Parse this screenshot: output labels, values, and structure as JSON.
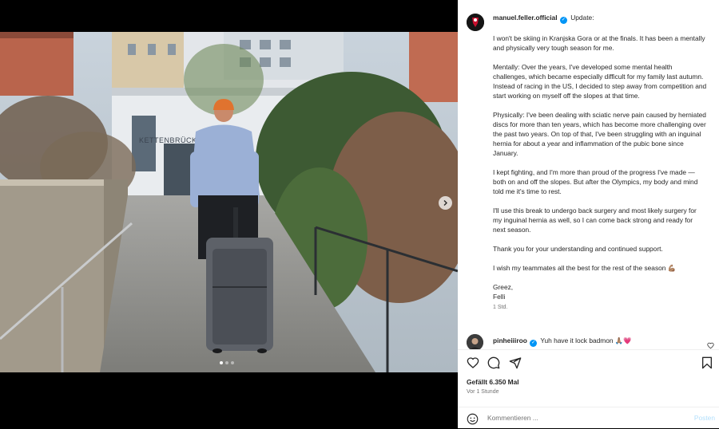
{
  "post": {
    "username": "manuel.feller.official",
    "verified": true,
    "caption_first": "Update:",
    "paragraphs": [
      "I won't be skiing in Kranjska Gora or at the finals. It has been a mentally and physically very tough season for me.",
      "Mentally: Over the years, I've developed some mental health challenges, which became especially difficult for my family last autumn. Instead of racing in the US, I decided to step away from competition and start working on myself off the slopes at that time.",
      "Physically: I've been dealing with sciatic nerve pain caused by herniated discs for more than ten years, which has become more challenging over the past two years. On top of that, I've been struggling with an inguinal hernia for about a year and inflammation of the pubic bone since January.",
      "I kept fighting, and I'm more than proud of the progress I've made — both on and off the slopes. But after the Olympics, my body and mind told me it's time to rest.",
      "I'll use this break to undergo back surgery and most likely surgery for my inguinal hernia as well, so I can come back strong and ready for next season.",
      "Thank you for your understanding and continued support.",
      "I wish my teammates all the best for the rest of the season 💪🏽",
      "Greez,\nFelli"
    ],
    "caption_time": "1 Std.",
    "photo_sign": "KETTENBRÜCKE",
    "image_count": 3,
    "active_image": 1
  },
  "comment": {
    "username": "pinheiiiroo",
    "verified": true,
    "text": "Yuh have it lock badmon 🙏🏽💗"
  },
  "actions": {
    "likes": "Gefällt 6.350 Mal",
    "ago": "Vor 1 Stunde",
    "comment_placeholder": "Kommentieren ...",
    "post_label": "Posten"
  },
  "colors": {
    "verified": "#0095f6",
    "post_button": "#b2dffc",
    "text": "#262626",
    "muted": "#737373"
  }
}
